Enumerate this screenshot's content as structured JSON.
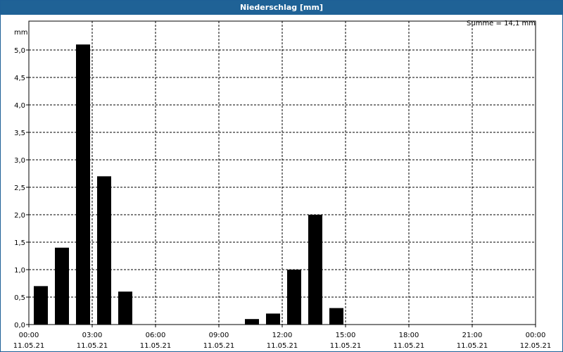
{
  "window": {
    "title": "Niederschlag [mm]"
  },
  "chart_data": {
    "type": "bar",
    "title": "Niederschlag [mm]",
    "ylabel": "mm",
    "annotation": "Summe = 14,1 mm",
    "ylim": [
      0,
      5.5
    ],
    "y_ticks": [
      "0,0",
      "0,5",
      "1,0",
      "1,5",
      "2,0",
      "2,5",
      "3,0",
      "3,5",
      "4,0",
      "4,5",
      "5,0"
    ],
    "x_ticks": [
      {
        "time": "00:00",
        "date": "11.05.21"
      },
      {
        "time": "03:00",
        "date": "11.05.21"
      },
      {
        "time": "06:00",
        "date": "11.05.21"
      },
      {
        "time": "09:00",
        "date": "11.05.21"
      },
      {
        "time": "12:00",
        "date": "11.05.21"
      },
      {
        "time": "15:00",
        "date": "11.05.21"
      },
      {
        "time": "18:00",
        "date": "11.05.21"
      },
      {
        "time": "21:00",
        "date": "11.05.21"
      },
      {
        "time": "00:00",
        "date": "12.05.21"
      }
    ],
    "bar_color": "#000000",
    "grid": true,
    "bars": [
      {
        "hour": 0,
        "value": 0.7
      },
      {
        "hour": 1,
        "value": 1.4
      },
      {
        "hour": 2,
        "value": 5.1
      },
      {
        "hour": 3,
        "value": 2.7
      },
      {
        "hour": 4,
        "value": 0.6
      },
      {
        "hour": 5,
        "value": 0.0
      },
      {
        "hour": 6,
        "value": 0.0
      },
      {
        "hour": 7,
        "value": 0.0
      },
      {
        "hour": 8,
        "value": 0.0
      },
      {
        "hour": 9,
        "value": 0.0
      },
      {
        "hour": 10,
        "value": 0.1
      },
      {
        "hour": 11,
        "value": 0.2
      },
      {
        "hour": 12,
        "value": 1.0
      },
      {
        "hour": 13,
        "value": 2.0
      },
      {
        "hour": 14,
        "value": 0.3
      },
      {
        "hour": 15,
        "value": 0.0
      },
      {
        "hour": 16,
        "value": 0.0
      },
      {
        "hour": 17,
        "value": 0.0
      },
      {
        "hour": 18,
        "value": 0.0
      },
      {
        "hour": 19,
        "value": 0.0
      },
      {
        "hour": 20,
        "value": 0.0
      },
      {
        "hour": 21,
        "value": 0.0
      },
      {
        "hour": 22,
        "value": 0.0
      },
      {
        "hour": 23,
        "value": 0.0
      }
    ]
  }
}
